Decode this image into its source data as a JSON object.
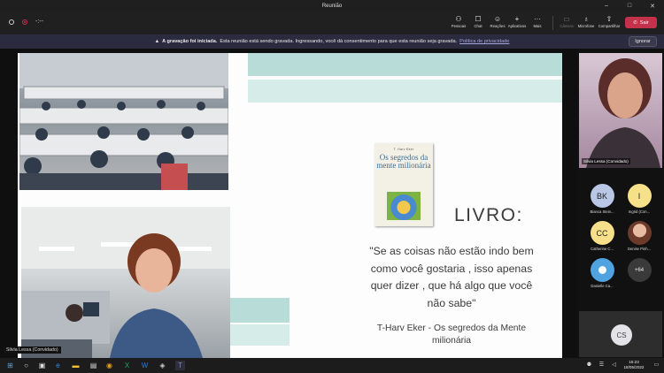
{
  "window": {
    "title": "Reunião"
  },
  "toolbar": {
    "timer": "-:--",
    "buttons": [
      {
        "label": "Pessoas",
        "icon": "people-icon"
      },
      {
        "label": "Chat",
        "icon": "chat-icon"
      },
      {
        "label": "Reações",
        "icon": "reactions-icon"
      },
      {
        "label": "Aplicativos",
        "icon": "apps-icon"
      },
      {
        "label": "Mais",
        "icon": "more-icon"
      },
      {
        "label": "Câmera",
        "icon": "camera-icon"
      },
      {
        "label": "Microfone",
        "icon": "microphone-icon"
      },
      {
        "label": "Compartilhar",
        "icon": "share-icon"
      }
    ],
    "leave_label": "Sair"
  },
  "banner": {
    "bold": "A gravação foi iniciada.",
    "text": "Esta reunião está sendo gravada. Ingressando, você dá consentimento para que esta reunião seja gravada.",
    "link": "Política de privacidade",
    "dismiss": "Ignorar"
  },
  "slide": {
    "book_author": "T. Harv Eker",
    "book_title": "Os segredos da mente milionária",
    "heading": "LIVRO:",
    "quote_lines": [
      "\"Se as coisas não estão indo bem",
      "como você gostaria , isso apenas",
      "quer dizer , que há algo que você",
      "não sabe\""
    ],
    "author_lines": [
      "T-Harv Eker - Os segredos da Mente",
      "milionária"
    ]
  },
  "stage": {
    "presenter_label": "Silvia Lessa (Convidado)"
  },
  "self_view": {
    "name": "Silvia Lessa (Convidado)"
  },
  "participants": [
    {
      "initials": "BK",
      "name": "Bianca Stein...",
      "color": "#b9c6e6"
    },
    {
      "initials": "I",
      "name": "Ingrid (Con...",
      "color": "#f7e08a"
    },
    {
      "initials": "CC",
      "name": "Catherine C...",
      "color": "#f7e08a"
    },
    {
      "initials": "",
      "name": "Denise Pinh...",
      "color": "#c98a7c"
    },
    {
      "initials": "",
      "name": "Danielle Ca...",
      "color": "#4fa3e0"
    },
    {
      "initials": "+64",
      "name": "",
      "color": "#3a3a3a"
    }
  ],
  "cs_tile": {
    "initials": "CS"
  },
  "taskbar": {
    "time": "15:23",
    "date": "18/05/2022"
  }
}
